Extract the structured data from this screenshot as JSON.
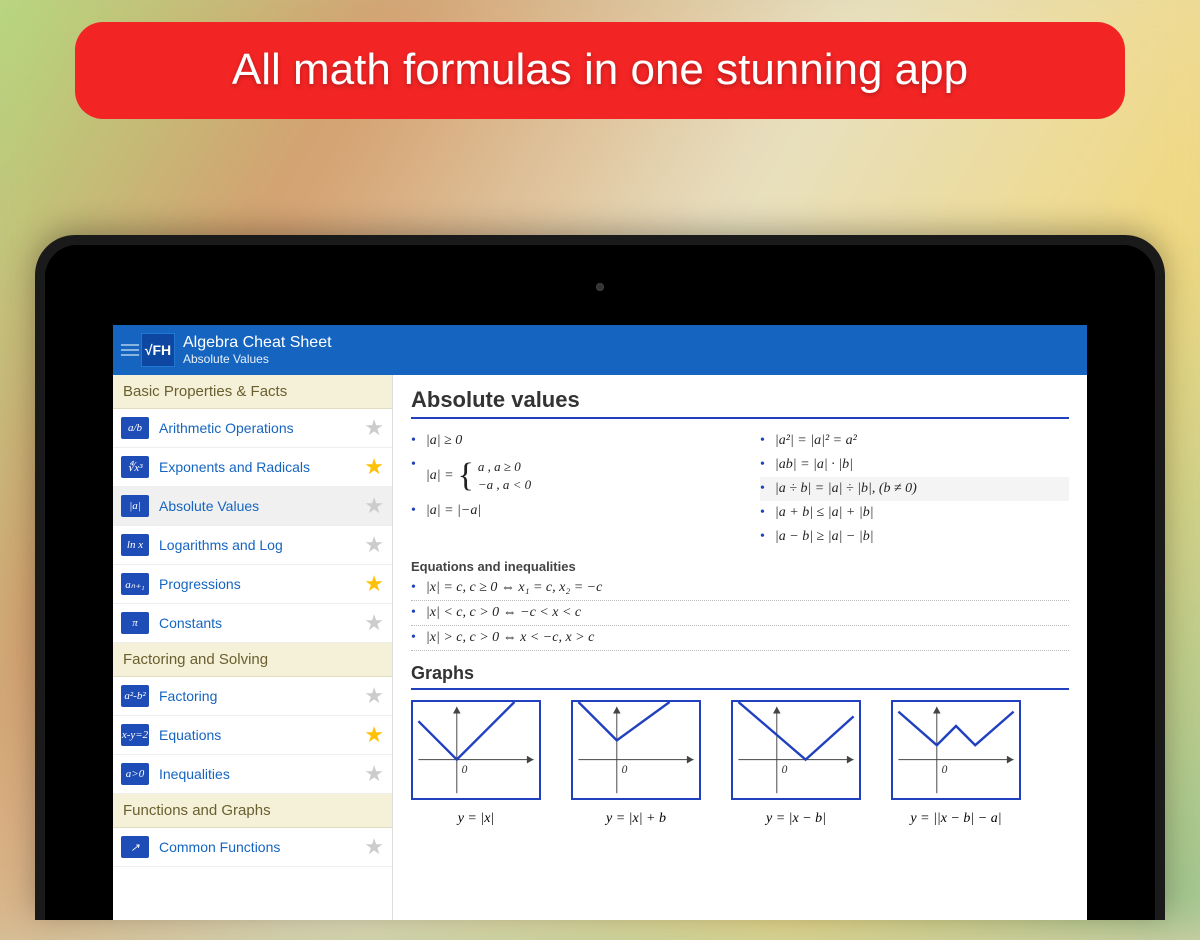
{
  "banner": {
    "text": "All math formulas in one stunning app"
  },
  "header": {
    "logo_text": "√FH",
    "title": "Algebra Cheat Sheet",
    "subtitle": "Absolute Values"
  },
  "sidebar": {
    "sections": [
      {
        "title": "Basic Properties & Facts",
        "items": [
          {
            "icon": "a/b",
            "label": "Arithmetic Operations",
            "starred": false,
            "selected": false
          },
          {
            "icon": "∜x³",
            "label": "Exponents and Radicals",
            "starred": true,
            "selected": false
          },
          {
            "icon": "|a|",
            "label": "Absolute Values",
            "starred": false,
            "selected": true
          },
          {
            "icon": "ln x",
            "label": "Logarithms and Log",
            "starred": false,
            "selected": false
          },
          {
            "icon": "aₙ₊₁",
            "label": "Progressions",
            "starred": true,
            "selected": false
          },
          {
            "icon": "π",
            "label": "Constants",
            "starred": false,
            "selected": false
          }
        ]
      },
      {
        "title": "Factoring and Solving",
        "items": [
          {
            "icon": "a²-b²",
            "label": "Factoring",
            "starred": false,
            "selected": false
          },
          {
            "icon": "x-y=2",
            "label": "Equations",
            "starred": true,
            "selected": false
          },
          {
            "icon": "a>0",
            "label": "Inequalities",
            "starred": false,
            "selected": false
          }
        ]
      },
      {
        "title": "Functions and Graphs",
        "items": [
          {
            "icon": "↗",
            "label": "Common Functions",
            "starred": false,
            "selected": false
          }
        ]
      }
    ]
  },
  "content": {
    "title": "Absolute values",
    "left_formulas": [
      "|a| ≥ 0",
      "piecewise",
      "|a| = |−a|"
    ],
    "piecewise": {
      "prefix": "|a| =",
      "rows": [
        "a      , a ≥ 0",
        "−a    , a < 0"
      ]
    },
    "right_formulas": [
      {
        "text": "|a²| = |a|² = a²",
        "highlight": false
      },
      {
        "text": "|ab| = |a| · |b|",
        "highlight": false
      },
      {
        "text": "|a ÷ b| = |a| ÷ |b|,  (b ≠ 0)",
        "highlight": true
      },
      {
        "text": "|a + b| ≤ |a| + |b|",
        "highlight": false
      },
      {
        "text": "|a − b| ≥ |a| − |b|",
        "highlight": false
      }
    ],
    "subsection_title": "Equations and inequalities",
    "eq_ineq": [
      "|x| = c, c ≥ 0 ⇔ x₁ = c, x₂ = −c",
      "|x| < c, c > 0 ⇔ −c < x < c",
      "|x| > c, c > 0 ⇔ x < −c, x > c"
    ],
    "graphs_title": "Graphs",
    "graphs": [
      {
        "caption": "y = |x|",
        "type": "v"
      },
      {
        "caption": "y = |x| + b",
        "type": "v_shift"
      },
      {
        "caption": "y = |x − b|",
        "type": "v_right"
      },
      {
        "caption": "y = ||x − b| − a|",
        "type": "w"
      }
    ]
  }
}
